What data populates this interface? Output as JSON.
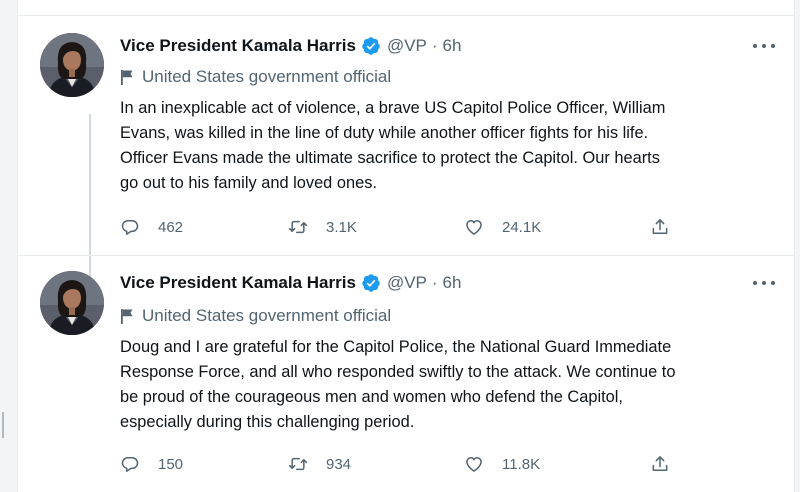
{
  "colors": {
    "text": "#0f1419",
    "secondary": "#536471",
    "verified": "#1d9bf0",
    "divider": "#e6ecf0",
    "thread_line": "#cfd9de"
  },
  "icons": {
    "verified": "verified-badge-icon",
    "flag": "flag-icon",
    "more": "more-icon",
    "reply": "reply-icon",
    "retweet": "retweet-icon",
    "like": "heart-icon",
    "share": "share-icon"
  },
  "tweets": [
    {
      "name": "Vice President Kamala Harris",
      "handle": "@VP",
      "separator": "·",
      "time": "6h",
      "label": "United States government official",
      "text_lines": [
        "In an inexplicable act of violence, a brave US Capitol Police Officer, William",
        "Evans, was killed in the line of duty while another officer fights for his life.",
        "Officer Evans made the ultimate sacrifice to protect the Capitol. Our hearts",
        "go out to his family and loved ones."
      ],
      "replies": "462",
      "retweets": "3.1K",
      "likes": "24.1K"
    },
    {
      "name": "Vice President Kamala Harris",
      "handle": "@VP",
      "separator": "·",
      "time": "6h",
      "label": "United States government official",
      "text_lines": [
        "Doug and I are grateful for the Capitol Police, the National Guard Immediate",
        "Response Force, and all who responded swiftly to the attack. We continue to",
        "be proud of the courageous men and women who defend the Capitol,",
        "especially during this challenging period."
      ],
      "replies": "150",
      "retweets": "934",
      "likes": "11.8K"
    }
  ]
}
